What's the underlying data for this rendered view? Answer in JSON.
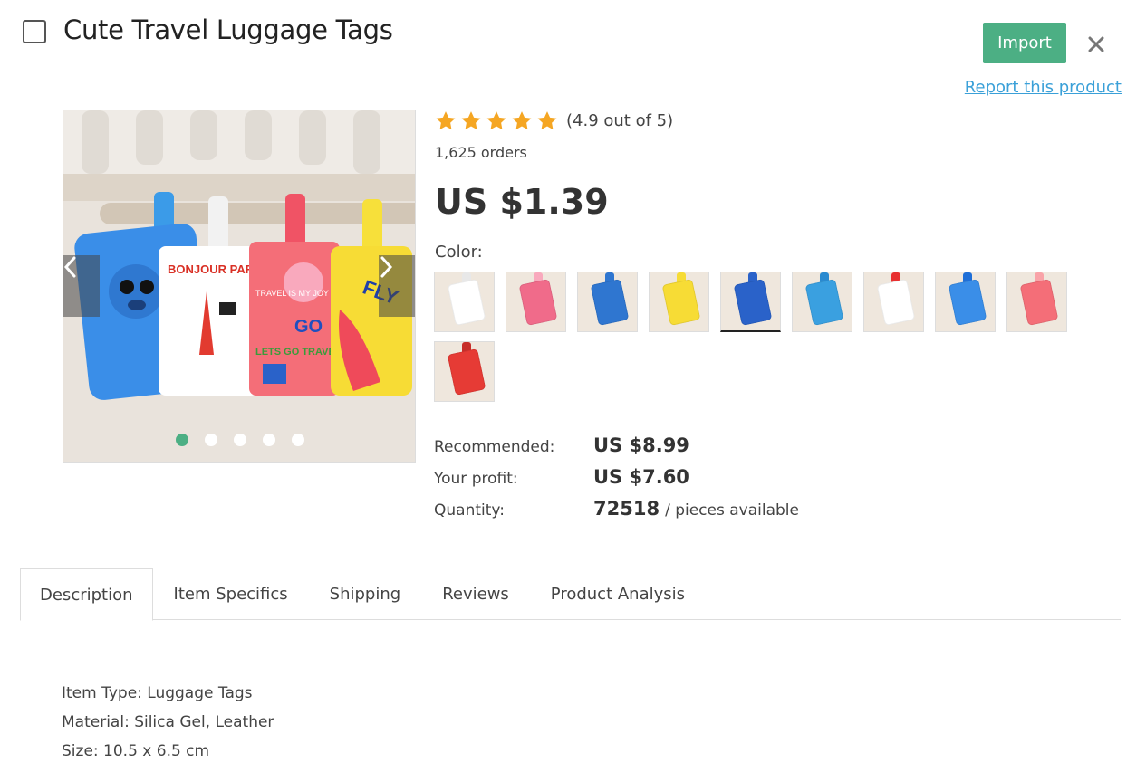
{
  "header": {
    "title": "Cute Travel Luggage Tags",
    "import_label": "Import",
    "report_label": "Report this product"
  },
  "rating": {
    "stars": 5,
    "text": "(4.9 out of 5)",
    "star_color": "#f5a623"
  },
  "orders": "1,625 orders",
  "price": "US $1.39",
  "color_label": "Color:",
  "swatches": [
    {
      "name": "white-paris",
      "tag_color": "#ffffff",
      "strap_color": "#e8e8e8",
      "selected": false
    },
    {
      "name": "pink",
      "tag_color": "#f06b8a",
      "strap_color": "#f9a9bd",
      "selected": false
    },
    {
      "name": "blue-plane",
      "tag_color": "#2f76d0",
      "strap_color": "#2f76d0",
      "selected": false
    },
    {
      "name": "yellow",
      "tag_color": "#f7dc35",
      "strap_color": "#f7dc35",
      "selected": false
    },
    {
      "name": "blue-cat",
      "tag_color": "#2a62c9",
      "strap_color": "#2a62c9",
      "selected": true
    },
    {
      "name": "blue-green",
      "tag_color": "#3aa0e0",
      "strap_color": "#2a8ad0",
      "selected": false
    },
    {
      "name": "white-london",
      "tag_color": "#ffffff",
      "strap_color": "#e83030",
      "selected": false
    },
    {
      "name": "blue-stitch",
      "tag_color": "#3a8ee8",
      "strap_color": "#1f6fd8",
      "selected": false
    },
    {
      "name": "pink-travel",
      "tag_color": "#f46e78",
      "strap_color": "#f9a3a8",
      "selected": false
    },
    {
      "name": "red-bus",
      "tag_color": "#e63b35",
      "strap_color": "#c72e2a",
      "selected": false
    }
  ],
  "stats": {
    "recommended_label": "Recommended:",
    "recommended_value": "US $8.99",
    "profit_label": "Your profit:",
    "profit_value": "US $7.60",
    "quantity_label": "Quantity:",
    "quantity_value": "72518",
    "quantity_suffix": "/ pieces available"
  },
  "tabs": [
    {
      "label": "Description",
      "active": true
    },
    {
      "label": "Item Specifics",
      "active": false
    },
    {
      "label": "Shipping",
      "active": false
    },
    {
      "label": "Reviews",
      "active": false
    },
    {
      "label": "Product Analysis",
      "active": false
    }
  ],
  "description": [
    "Item Type: Luggage Tags",
    "Material: Silica Gel, Leather",
    "Size: 10.5 x 6.5 cm"
  ],
  "carousel": {
    "slide_count": 5,
    "active_slide": 0,
    "accent_color": "#4caf84"
  },
  "image_text": {
    "paris_tag": "BONJOUR PARIS",
    "travel_tag": "TRAVEL IS MY JOY",
    "go_text": "GO",
    "lets_go": "LETS GO TRAVEL",
    "fly": "FLY"
  }
}
